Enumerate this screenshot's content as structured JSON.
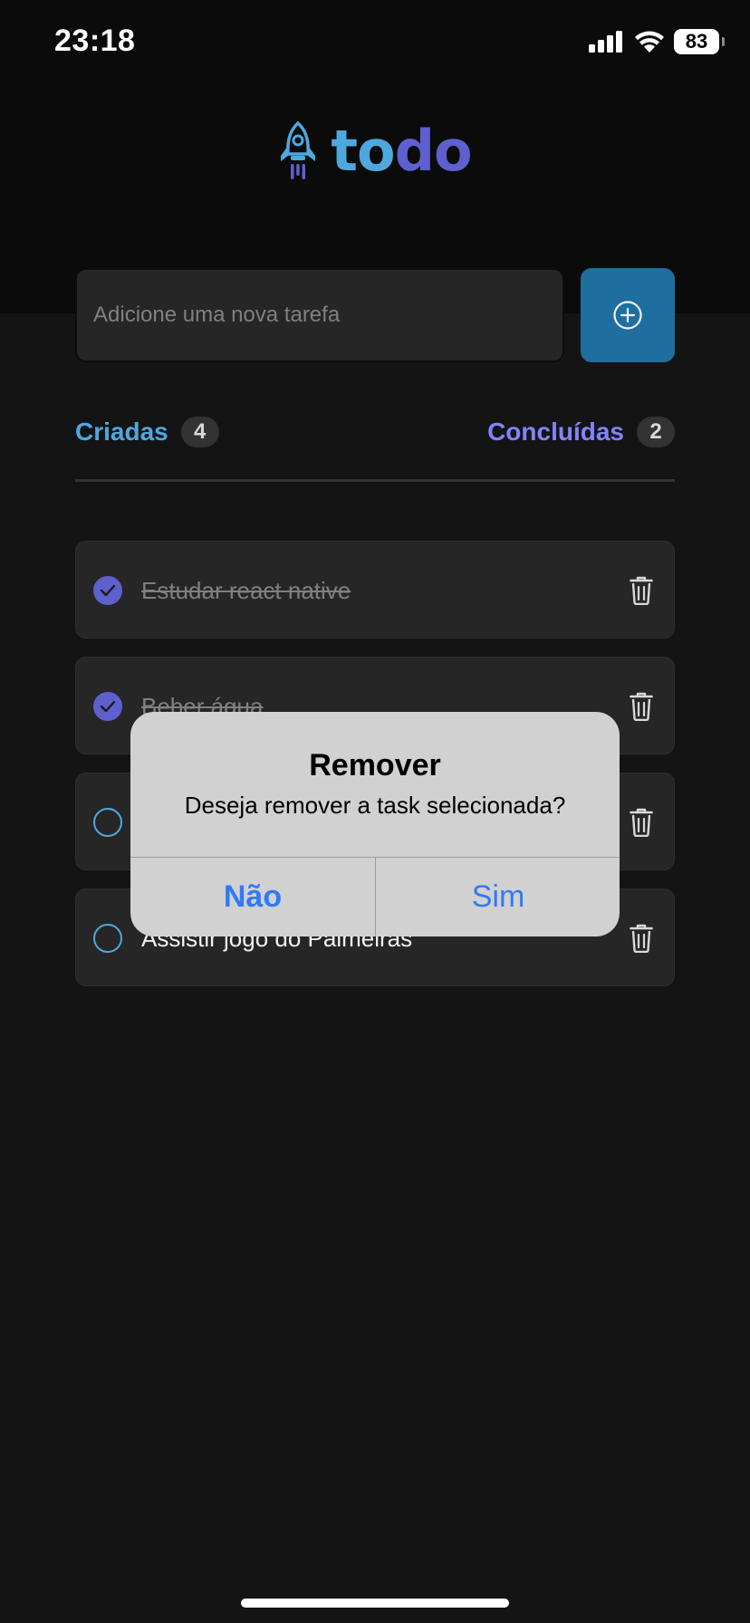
{
  "status_bar": {
    "time": "23:18",
    "battery": "83",
    "icons": [
      "cellular-signal-icon",
      "wifi-icon",
      "battery-icon"
    ]
  },
  "logo": {
    "icon": "rocket-icon",
    "text_part1": "to",
    "text_part2": "do"
  },
  "new_task": {
    "placeholder": "Adicione uma nova tarefa",
    "value": "",
    "add_icon": "plus-circle-icon"
  },
  "counters": {
    "created_label": "Criadas",
    "created_count": "4",
    "done_label": "Concluídas",
    "done_count": "2"
  },
  "tasks": [
    {
      "text": "Estudar react native",
      "done": true
    },
    {
      "text": "Beber água",
      "done": true
    },
    {
      "text": "",
      "done": false
    },
    {
      "text": "Assistir jogo do Palmeiras",
      "done": false
    }
  ],
  "alert": {
    "title": "Remover",
    "message": "Deseja remover a task selecionada?",
    "cancel_label": "Não",
    "confirm_label": "Sim"
  },
  "colors": {
    "background": "#141414",
    "top_band": "#0b0b0c",
    "blue": "#4ea8de",
    "purple": "#5e60ce",
    "purple_light": "#8284fa",
    "button_blue": "#1e6f9f",
    "alert_bg": "#d1d1d1",
    "alert_button": "#2f7bf5"
  }
}
